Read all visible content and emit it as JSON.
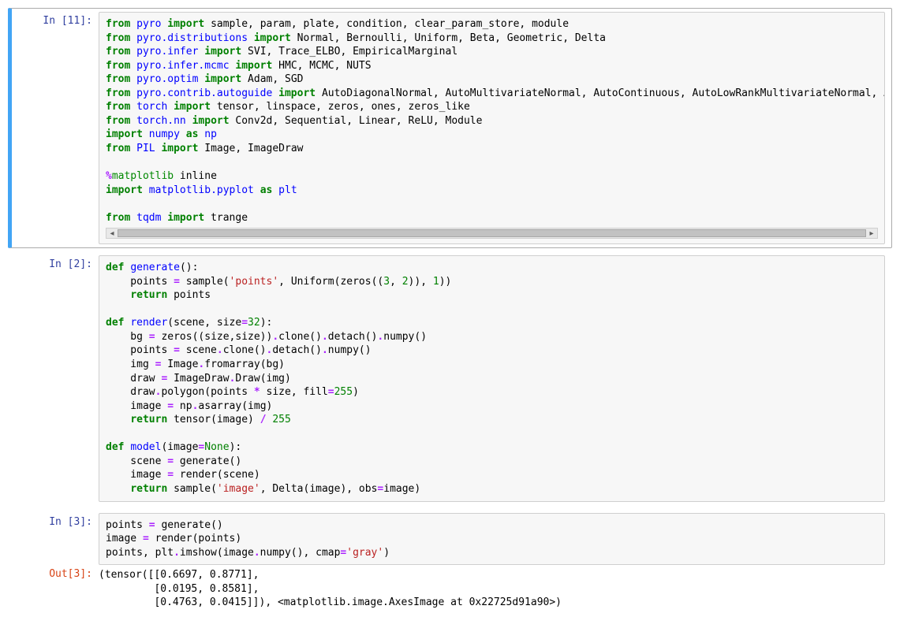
{
  "cells": [
    {
      "prompt_in": "In [11]:",
      "selected": true,
      "has_scrollbar": true,
      "code_html": "<span class='kn'>from</span> <span class='nm'>pyro</span> <span class='kn'>import</span> sample, param, plate, condition, clear_param_store, module\n<span class='kn'>from</span> <span class='nm'>pyro.distributions</span> <span class='kn'>import</span> Normal, Bernoulli, Uniform, Beta, Geometric, Delta\n<span class='kn'>from</span> <span class='nm'>pyro.infer</span> <span class='kn'>import</span> SVI, Trace_ELBO, EmpiricalMarginal\n<span class='kn'>from</span> <span class='nm'>pyro.infer.mcmc</span> <span class='kn'>import</span> HMC, MCMC, NUTS\n<span class='kn'>from</span> <span class='nm'>pyro.optim</span> <span class='kn'>import</span> Adam, SGD\n<span class='kn'>from</span> <span class='nm'>pyro.contrib.autoguide</span> <span class='kn'>import</span> AutoDiagonalNormal, AutoMultivariateNormal, AutoContinuous, AutoLowRankMultivariateNormal, Aut\n<span class='kn'>from</span> <span class='nm'>torch</span> <span class='kn'>import</span> tensor, linspace, zeros, ones, zeros_like\n<span class='kn'>from</span> <span class='nm'>torch.nn</span> <span class='kn'>import</span> Conv2d, Sequential, Linear, ReLU, Module\n<span class='kn'>import</span> <span class='nm'>numpy</span> <span class='kn'>as</span> <span class='nm'>np</span>\n<span class='kn'>from</span> <span class='nm'>PIL</span> <span class='kn'>import</span> Image, ImageDraw\n\n<span class='op'>%</span><span class='mg'>matplotlib</span> inline\n<span class='kn'>import</span> <span class='nm'>matplotlib.pyplot</span> <span class='kn'>as</span> <span class='nm'>plt</span>\n\n<span class='kn'>from</span> <span class='nm'>tqdm</span> <span class='kn'>import</span> trange"
    },
    {
      "prompt_in": "In [2]:",
      "selected": false,
      "has_scrollbar": false,
      "code_html": "<span class='kw'>def</span> <span class='nm'>generate</span>():\n    points <span class='op'>=</span> sample(<span class='st'>'points'</span>, Uniform(zeros((<span class='num'>3</span>, <span class='num'>2</span>)), <span class='num'>1</span>))\n    <span class='kw'>return</span> points\n\n<span class='kw'>def</span> <span class='nm'>render</span>(scene, size<span class='op'>=</span><span class='num'>32</span>):\n    bg <span class='op'>=</span> zeros((size,size))<span class='op'>.</span>clone()<span class='op'>.</span>detach()<span class='op'>.</span>numpy()\n    points <span class='op'>=</span> scene<span class='op'>.</span>clone()<span class='op'>.</span>detach()<span class='op'>.</span>numpy()\n    img <span class='op'>=</span> Image<span class='op'>.</span>fromarray(bg)\n    draw <span class='op'>=</span> ImageDraw<span class='op'>.</span>Draw(img)\n    draw<span class='op'>.</span>polygon(points <span class='op'>*</span> size, fill<span class='op'>=</span><span class='num'>255</span>)\n    image <span class='op'>=</span> np<span class='op'>.</span>asarray(img)\n    <span class='kw'>return</span> tensor(image) <span class='op'>/</span> <span class='num'>255</span>\n\n<span class='kw'>def</span> <span class='nm'>model</span>(image<span class='op'>=</span><span class='bi'>None</span>):\n    scene <span class='op'>=</span> generate()\n    image <span class='op'>=</span> render(scene)\n    <span class='kw'>return</span> sample(<span class='st'>'image'</span>, Delta(image), obs<span class='op'>=</span>image)"
    },
    {
      "prompt_in": "In [3]:",
      "prompt_out": "Out[3]:",
      "selected": false,
      "has_scrollbar": false,
      "code_html": "points <span class='op'>=</span> generate()\nimage <span class='op'>=</span> render(points)\npoints, plt<span class='op'>.</span>imshow(image<span class='op'>.</span>numpy(), cmap<span class='op'>=</span><span class='st'>'gray'</span>)",
      "output_text": "(tensor([[0.6697, 0.8771],\n         [0.0195, 0.8581],\n         [0.4763, 0.0415]]), <matplotlib.image.AxesImage at 0x22725d91a90>)"
    }
  ]
}
